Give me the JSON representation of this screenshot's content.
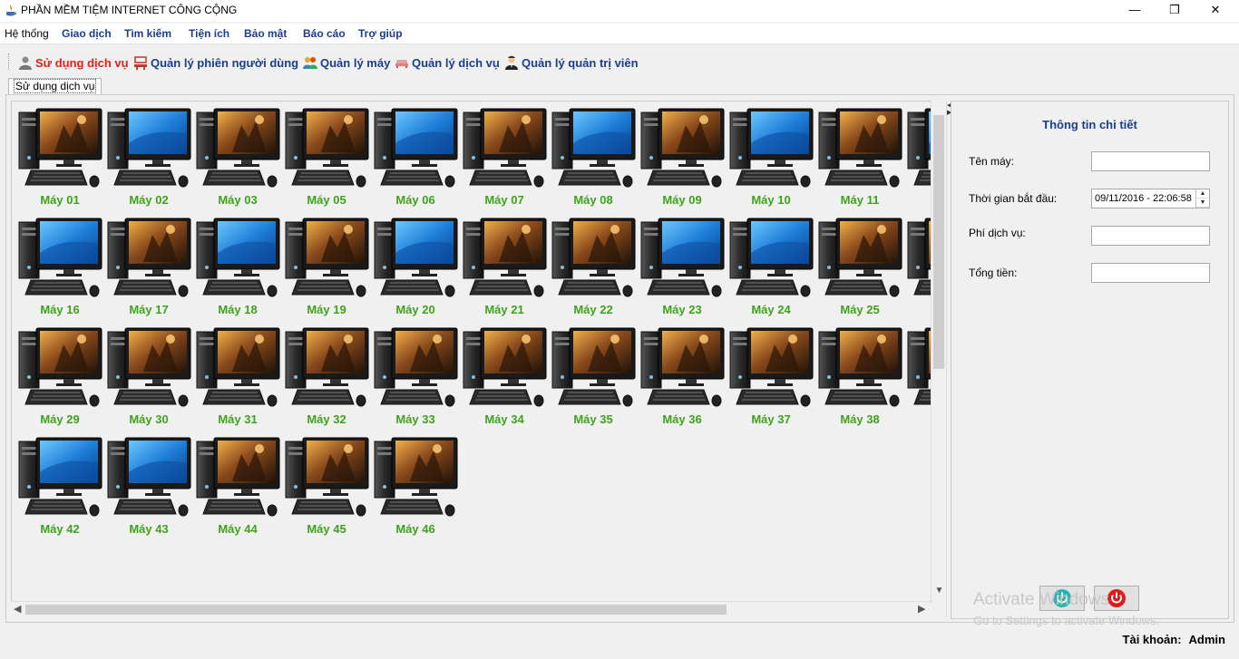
{
  "window": {
    "title": "PHẦN MỀM TIỆM INTERNET CÔNG CỘNG",
    "minimize": "—",
    "restore": "❐",
    "close": "✕"
  },
  "menu": [
    "Hệ thống",
    "Giao dịch",
    "Tìm kiếm",
    "Tiện ích",
    "Bảo mật",
    "Báo cáo",
    "Trợ giúp"
  ],
  "toolbar": [
    {
      "label": "Sử dụng dịch vụ",
      "icon": "user-icon",
      "active": true
    },
    {
      "label": "Quản lý phiên người dùng",
      "icon": "session-icon",
      "active": false
    },
    {
      "label": "Quản lý máy",
      "icon": "users-icon",
      "active": false
    },
    {
      "label": "Quản lý dịch vụ",
      "icon": "service-icon",
      "active": false
    },
    {
      "label": "Quản lý quản trị viên",
      "icon": "admin-icon",
      "active": false
    }
  ],
  "tab": {
    "label": "Sử dụng dịch vụ"
  },
  "machines": [
    {
      "name": "Máy 01",
      "screen": "game"
    },
    {
      "name": "Máy 02",
      "screen": "blue"
    },
    {
      "name": "Máy 03",
      "screen": "game"
    },
    {
      "name": "Máy 05",
      "screen": "game"
    },
    {
      "name": "Máy 06",
      "screen": "blue"
    },
    {
      "name": "Máy 07",
      "screen": "game"
    },
    {
      "name": "Máy 08",
      "screen": "blue"
    },
    {
      "name": "Máy 09",
      "screen": "game"
    },
    {
      "name": "Máy 10",
      "screen": "blue"
    },
    {
      "name": "Máy 11",
      "screen": "game"
    },
    {
      "name": "M",
      "screen": "blue"
    },
    {
      "name": "Máy 16",
      "screen": "blue"
    },
    {
      "name": "Máy 17",
      "screen": "game"
    },
    {
      "name": "Máy 18",
      "screen": "blue"
    },
    {
      "name": "Máy 19",
      "screen": "game"
    },
    {
      "name": "Máy 20",
      "screen": "blue"
    },
    {
      "name": "Máy 21",
      "screen": "game"
    },
    {
      "name": "Máy 22",
      "screen": "game"
    },
    {
      "name": "Máy 23",
      "screen": "blue"
    },
    {
      "name": "Máy 24",
      "screen": "blue"
    },
    {
      "name": "Máy 25",
      "screen": "game"
    },
    {
      "name": "M",
      "screen": "game"
    },
    {
      "name": "Máy 29",
      "screen": "game"
    },
    {
      "name": "Máy 30",
      "screen": "game"
    },
    {
      "name": "Máy 31",
      "screen": "game"
    },
    {
      "name": "Máy 32",
      "screen": "game"
    },
    {
      "name": "Máy 33",
      "screen": "game"
    },
    {
      "name": "Máy 34",
      "screen": "game"
    },
    {
      "name": "Máy 35",
      "screen": "game"
    },
    {
      "name": "Máy 36",
      "screen": "game"
    },
    {
      "name": "Máy 37",
      "screen": "game"
    },
    {
      "name": "Máy 38",
      "screen": "game"
    },
    {
      "name": "M",
      "screen": "game"
    },
    {
      "name": "Máy 42",
      "screen": "blue"
    },
    {
      "name": "Máy 43",
      "screen": "blue"
    },
    {
      "name": "Máy 44",
      "screen": "game"
    },
    {
      "name": "Máy 45",
      "screen": "game"
    },
    {
      "name": "Máy 46",
      "screen": "game"
    }
  ],
  "detail": {
    "title": "Thông tin chi tiết",
    "machine_name_label": "Tên máy:",
    "machine_name_value": "",
    "start_time_label": "Thời gian bắt đầu:",
    "start_time_value": "09/11/2016 - 22:06:58",
    "service_fee_label": "Phí dịch vụ:",
    "service_fee_value": "",
    "total_label": "Tổng tiền:",
    "total_value": ""
  },
  "watermark": {
    "line1": "Activate Windows",
    "line2": "Go to Settings to activate Windows."
  },
  "status": {
    "account_label": "Tài khoản:",
    "account_value": "Admin"
  },
  "colors": {
    "menu": "#1a3d8f",
    "active": "#e0201a",
    "machine_label": "#3ea31b",
    "power_on": "#2bb3b0",
    "power_off": "#e01b1b"
  }
}
